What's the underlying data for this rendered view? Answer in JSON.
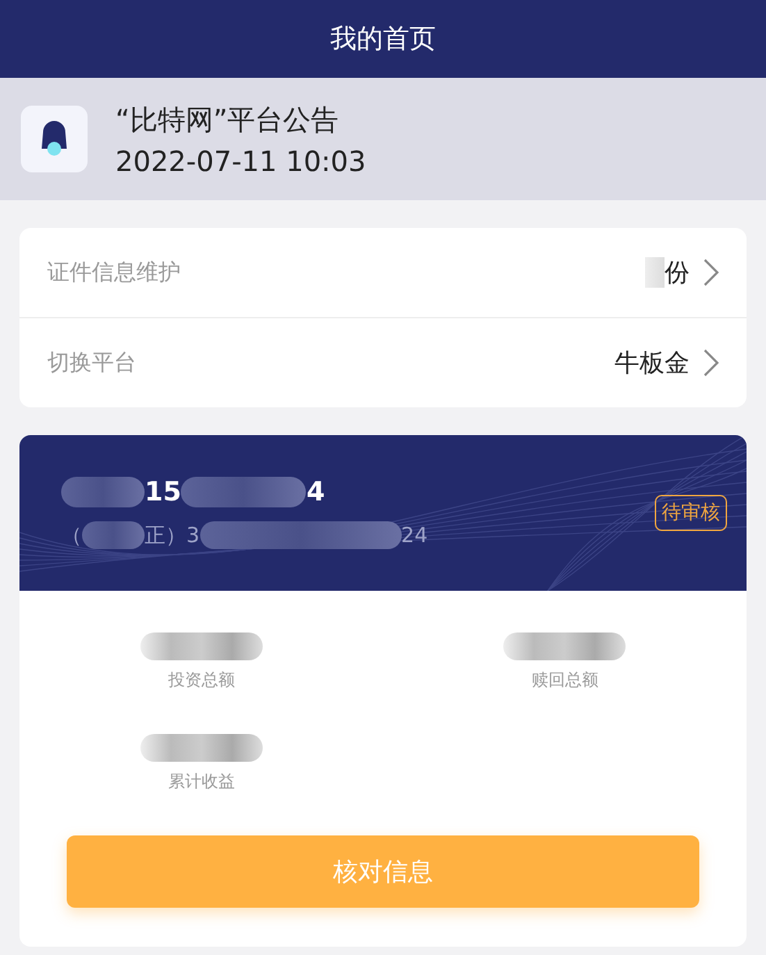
{
  "header": {
    "title": "我的首页"
  },
  "notice": {
    "title": "“比特网”平台公告",
    "time": "2022-07-11 10:03"
  },
  "menu": [
    {
      "label": "证件信息维护",
      "value": [
        {
          "kind": "blur"
        },
        {
          "kind": "text",
          "text": "份"
        }
      ]
    },
    {
      "label": "切换平台",
      "value": [
        {
          "kind": "text",
          "text": "牛板金"
        }
      ]
    }
  ],
  "account": {
    "line_1": [
      {
        "kind": "blur"
      },
      {
        "kind": "text",
        "text": "15"
      },
      {
        "kind": "blur"
      },
      {
        "kind": "text",
        "text": "4"
      }
    ],
    "line_2": [
      {
        "kind": "text",
        "text": "（"
      },
      {
        "kind": "blur"
      },
      {
        "kind": "text",
        "text": "正）3"
      },
      {
        "kind": "blur"
      },
      {
        "kind": "text",
        "text": "24"
      }
    ],
    "status": "待审核",
    "stats": [
      {
        "label": "投资总额"
      },
      {
        "label": "赎回总额"
      },
      {
        "label": "累计收益"
      }
    ],
    "button": "核对信息"
  }
}
